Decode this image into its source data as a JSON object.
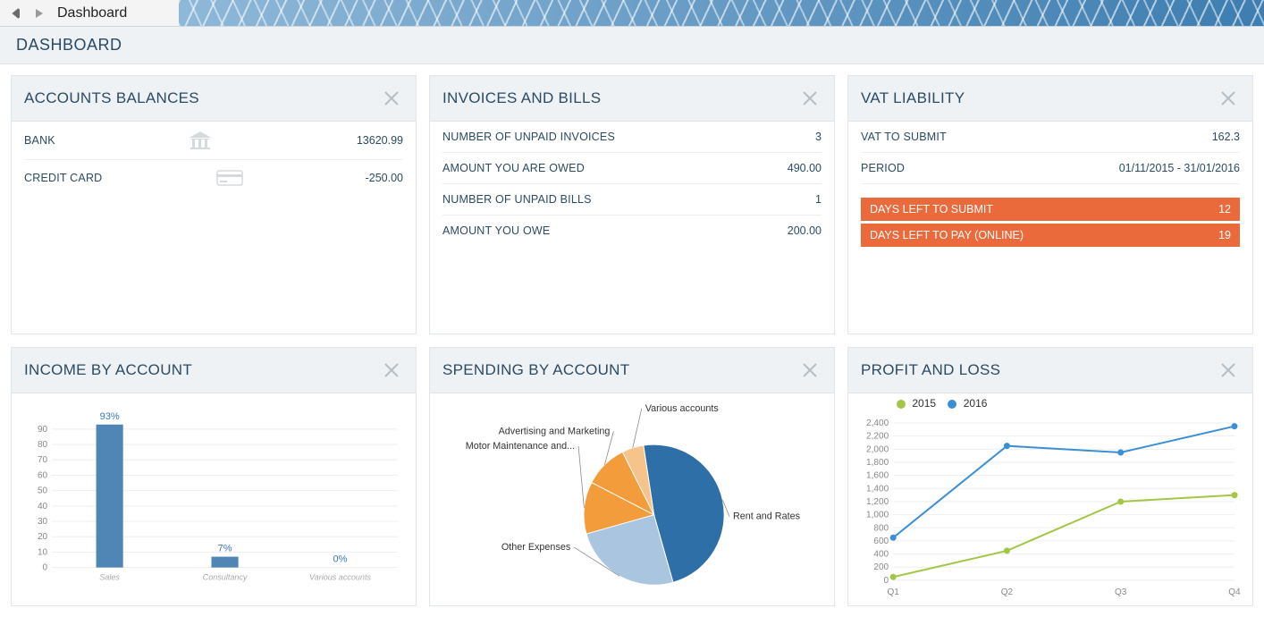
{
  "topbar": {
    "title": "Dashboard"
  },
  "subheader": {
    "title": "DASHBOARD"
  },
  "cards": {
    "balances": {
      "title": "ACCOUNTS BALANCES",
      "rows": [
        {
          "label": "BANK",
          "icon": "bank-icon",
          "value": "13620.99"
        },
        {
          "label": "CREDIT CARD",
          "icon": "card-icon",
          "value": "-250.00"
        }
      ]
    },
    "invoices": {
      "title": "INVOICES AND BILLS",
      "rows": [
        {
          "label": "NUMBER OF UNPAID INVOICES",
          "value": "3"
        },
        {
          "label": "AMOUNT YOU ARE OWED",
          "value": "490.00"
        },
        {
          "label": "NUMBER OF UNPAID BILLS",
          "value": "1"
        },
        {
          "label": "AMOUNT YOU OWE",
          "value": "200.00"
        }
      ]
    },
    "vat": {
      "title": "VAT LIABILITY",
      "rows": [
        {
          "label": "VAT TO SUBMIT",
          "value": "162.3"
        },
        {
          "label": "PERIOD",
          "value": "01/11/2015 - 31/01/2016"
        }
      ],
      "alerts": [
        {
          "label": "DAYS LEFT TO SUBMIT",
          "value": "12"
        },
        {
          "label": "DAYS LEFT TO PAY (ONLINE)",
          "value": "19"
        }
      ]
    },
    "income": {
      "title": "INCOME BY ACCOUNT"
    },
    "spending": {
      "title": "SPENDING BY ACCOUNT"
    },
    "pnl": {
      "title": "PROFIT AND LOSS",
      "legend": {
        "a": "2015",
        "b": "2016"
      }
    }
  },
  "chart_data": [
    {
      "id": "income_by_account",
      "type": "bar",
      "title": "INCOME BY ACCOUNT",
      "ylabel": "",
      "ylim": [
        0,
        100
      ],
      "yticks": [
        0,
        10,
        20,
        30,
        40,
        50,
        60,
        70,
        80,
        90
      ],
      "categories": [
        "Sales",
        "Consultancy",
        "Various accounts"
      ],
      "values": [
        93,
        7,
        0
      ],
      "value_labels": [
        "93%",
        "7%",
        "0%"
      ],
      "color": "#4f86b5"
    },
    {
      "id": "spending_by_account",
      "type": "pie",
      "title": "SPENDING BY ACCOUNT",
      "series": [
        {
          "name": "Rent and Rates",
          "value": 48,
          "color": "#2f6fa8"
        },
        {
          "name": "Other Expenses",
          "value": 25,
          "color": "#a9c5e0"
        },
        {
          "name": "Motor Maintenance and...",
          "value": 12,
          "color": "#f39c3c"
        },
        {
          "name": "Advertising and Marketing",
          "value": 10,
          "color": "#f39c3c"
        },
        {
          "name": "Various accounts",
          "value": 5,
          "color": "#f6c38b"
        }
      ]
    },
    {
      "id": "profit_and_loss",
      "type": "line",
      "title": "PROFIT AND LOSS",
      "xlabel": "",
      "ylabel": "",
      "ylim": [
        0,
        2400
      ],
      "yticks": [
        0,
        200,
        400,
        600,
        800,
        1000,
        1200,
        1400,
        1600,
        1800,
        2000,
        2200,
        2400
      ],
      "categories": [
        "Q1",
        "Q2",
        "Q3",
        "Q4"
      ],
      "series": [
        {
          "name": "2015",
          "color": "#a3c646",
          "values": [
            50,
            450,
            1200,
            1300
          ]
        },
        {
          "name": "2016",
          "color": "#3b8fd4",
          "values": [
            650,
            2050,
            1950,
            2350
          ]
        }
      ]
    }
  ]
}
